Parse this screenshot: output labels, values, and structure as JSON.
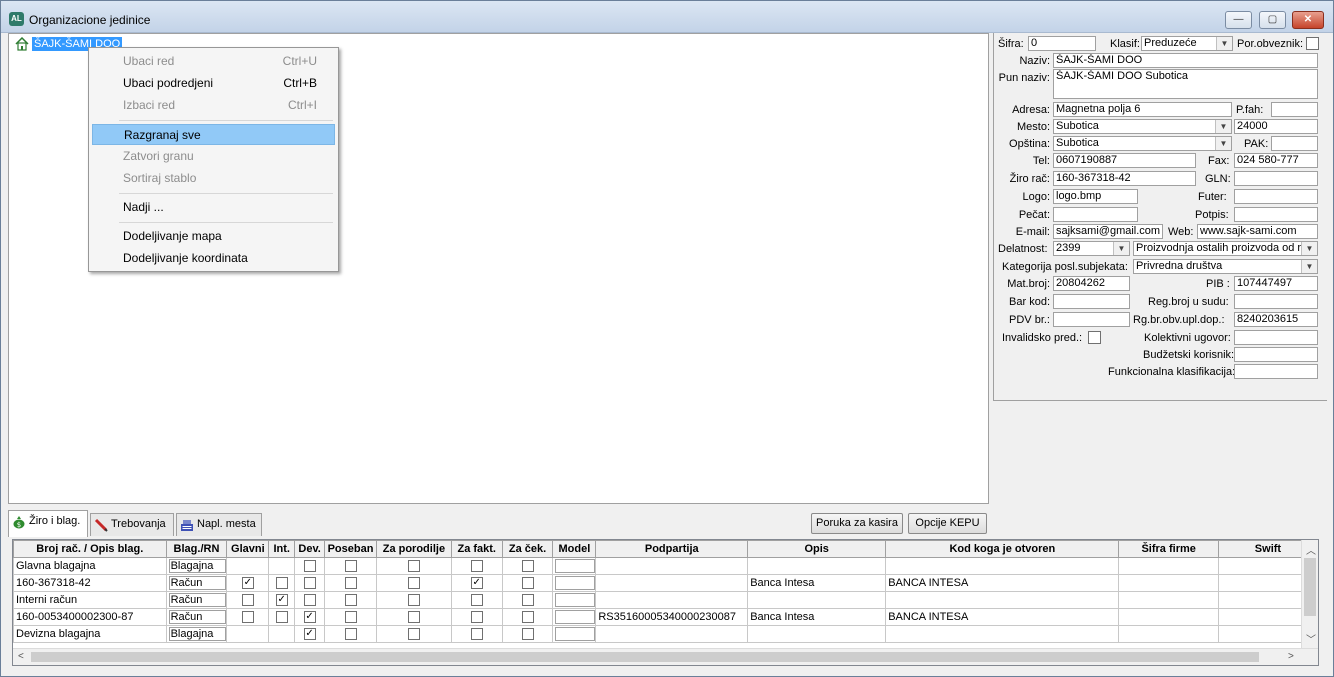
{
  "window": {
    "title": "Organizacione jedinice",
    "app_icon_text": "AL",
    "minimize": "—",
    "maximize": "▢",
    "close": "✕"
  },
  "tree": {
    "root_label": "ŠAJK-ŠAMI DOO"
  },
  "context_menu": {
    "items": [
      {
        "label": "Ubaci red",
        "shortcut": "Ctrl+U",
        "enabled": false
      },
      {
        "label": "Ubaci podredjeni",
        "shortcut": "Ctrl+B",
        "enabled": true
      },
      {
        "label": "Izbaci red",
        "shortcut": "Ctrl+I",
        "enabled": false
      },
      {
        "label": "Razgranaj sve",
        "shortcut": "",
        "enabled": true,
        "highlighted": true
      },
      {
        "label": "Zatvori granu",
        "shortcut": "",
        "enabled": false
      },
      {
        "label": "Sortiraj stablo",
        "shortcut": "",
        "enabled": false
      },
      {
        "label": "Nadji ...",
        "shortcut": "",
        "enabled": true
      },
      {
        "label": "Dodeljivanje mapa",
        "shortcut": "",
        "enabled": true
      },
      {
        "label": "Dodeljivanje koordinata",
        "shortcut": "",
        "enabled": true
      }
    ]
  },
  "properties": {
    "sifra_label": "Šifra:",
    "sifra": "0",
    "klasif_label": "Klasif:",
    "klasif": "Preduzeće",
    "por_obveznik_label": "Por.obveznik:",
    "naziv_label": "Naziv:",
    "naziv": "ŠAJK-ŠAMI DOO",
    "pun_naziv_label": "Pun naziv:",
    "pun_naziv": "ŠAJK-ŠAMI DOO Subotica",
    "adresa_label": "Adresa:",
    "adresa": "Magnetna polja 6",
    "pfah_label": "P.fah:",
    "pfah": "",
    "mesto_label": "Mesto:",
    "mesto": "Subotica",
    "postanski_broj": "24000",
    "opstina_label": "Opština:",
    "opstina": "Subotica",
    "pak_label": "PAK:",
    "pak": "",
    "tel_label": "Tel:",
    "tel": "0607190887",
    "fax_label": "Fax:",
    "fax": "024 580-777",
    "ziro_label": "Žiro rač:",
    "ziro": "160-367318-42",
    "gln_label": "GLN:",
    "gln": "",
    "logo_label": "Logo:",
    "logo": "logo.bmp",
    "futer_label": "Futer:",
    "futer": "",
    "pecat_label": "Pečat:",
    "pecat": "",
    "potpis_label": "Potpis:",
    "potpis": "",
    "email_label": "E-mail:",
    "email": "sajksami@gmail.com",
    "web_label": "Web:",
    "web": "www.sajk-sami.com",
    "delatnost_label": "Delatnost:",
    "delatnost_sifra": "2399",
    "delatnost_opis": "Proizvodnja ostalih proizvoda od r",
    "kategorija_label": "Kategorija posl.subjekata:",
    "kategorija": "Privredna društva",
    "mat_broj_label": "Mat.broj:",
    "mat_broj": "20804262",
    "pib_label": "PIB :",
    "pib": "107447497",
    "bar_kod_label": "Bar kod:",
    "bar_kod": "",
    "reg_broj_label": "Reg.broj u sudu:",
    "reg_broj": "",
    "pdv_label": "PDV br.:",
    "pdv": "",
    "rg_br_label": "Rg.br.obv.upl.dop.:",
    "rg_br": "8240203615",
    "invalidsko_label": "Invalidsko pred.:",
    "kolektivni_label": "Kolektivni ugovor:",
    "kolektivni": "",
    "budzetski_label": "Budžetski korisnik:",
    "budzetski": "",
    "funkcionalna_label": "Funkcionalna klasifikacija:",
    "funkcionalna": ""
  },
  "tabs": [
    {
      "label": "Žiro i blag.",
      "icon": "money-bag-icon"
    },
    {
      "label": "Trebovanja",
      "icon": "pencil-icon"
    },
    {
      "label": "Napl. mesta",
      "icon": "cash-register-icon"
    }
  ],
  "buttons": {
    "poruka": "Poruka za kasira",
    "opcije": "Opcije KEPU"
  },
  "grid": {
    "columns": [
      "Broj rač. / Opis blag.",
      "Blag./RN",
      "Glavni",
      "Int.",
      "Dev.",
      "Poseban",
      "Za porodilje",
      "Za fakt.",
      "Za ček.",
      "Model",
      "Podpartija",
      "Opis",
      "Kod koga je otvoren",
      "Šifra firme",
      "Swift"
    ],
    "rows": [
      {
        "broj": "Glavna blagajna",
        "tip": "Blagajna",
        "glavni": null,
        "int": null,
        "dev": false,
        "poseban": false,
        "porodilje": false,
        "fakt": false,
        "cek": false,
        "model": "",
        "podpartija": "",
        "opis": "",
        "kod_koga": "",
        "sifra_firme": "",
        "swift": ""
      },
      {
        "broj": "160-367318-42",
        "tip": "Račun",
        "glavni": true,
        "int": false,
        "dev": false,
        "poseban": false,
        "porodilje": false,
        "fakt": true,
        "cek": false,
        "model": "",
        "podpartija": "",
        "opis": "Banca Intesa",
        "kod_koga": "BANCA INTESA",
        "sifra_firme": "",
        "swift": ""
      },
      {
        "broj": "Interni račun",
        "tip": "Račun",
        "glavni": false,
        "int": true,
        "dev": false,
        "poseban": false,
        "porodilje": false,
        "fakt": false,
        "cek": false,
        "model": "",
        "podpartija": "",
        "opis": "",
        "kod_koga": "",
        "sifra_firme": "",
        "swift": ""
      },
      {
        "broj": "160-0053400002300-87",
        "tip": "Račun",
        "glavni": false,
        "int": false,
        "dev": true,
        "poseban": false,
        "porodilje": false,
        "fakt": false,
        "cek": false,
        "model": "",
        "podpartija": "RS35160005340000230087",
        "opis": "Banca Intesa",
        "kod_koga": "BANCA INTESA",
        "sifra_firme": "",
        "swift": ""
      },
      {
        "broj": "Devizna blagajna",
        "tip": "Blagajna",
        "glavni": null,
        "int": null,
        "dev": true,
        "poseban": false,
        "porodilje": false,
        "fakt": false,
        "cek": false,
        "model": "",
        "podpartija": "",
        "opis": "",
        "kod_koga": "",
        "sifra_firme": "",
        "swift": ""
      }
    ]
  },
  "colors": {
    "selection": "#3399ff",
    "menu_highlight": "#91c9f7",
    "close_button": "#c6442b"
  }
}
